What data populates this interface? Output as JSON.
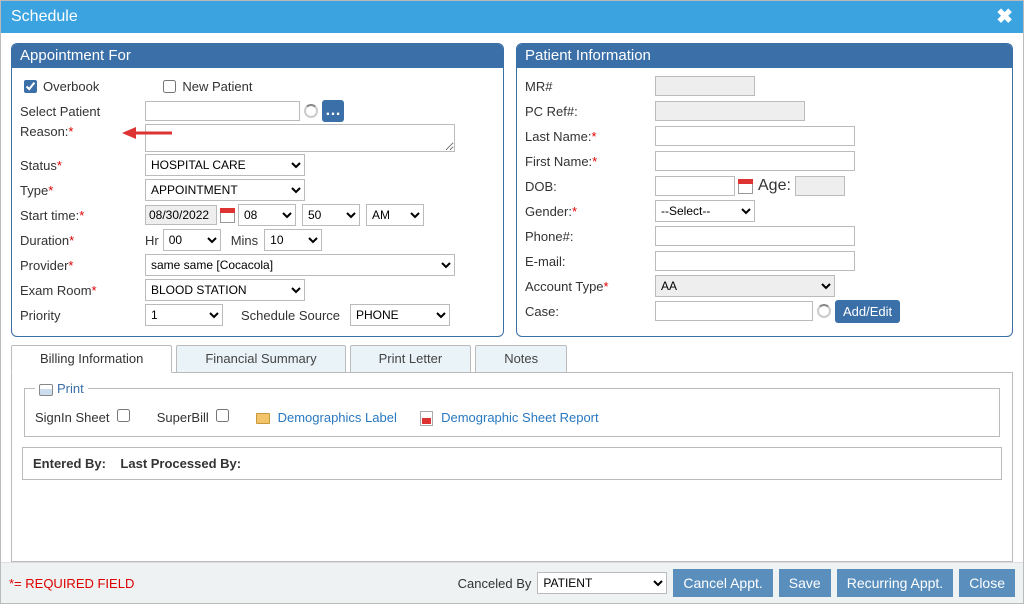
{
  "window": {
    "title": "Schedule"
  },
  "appointment": {
    "header": "Appointment For",
    "overbook": {
      "label": "Overbook",
      "checked": true
    },
    "new_patient": {
      "label": "New Patient",
      "checked": false
    },
    "select_patient_label": "Select Patient",
    "select_patient_value": "",
    "reason_label": "Reason:",
    "reason_value": "",
    "status_label": "Status",
    "status_value": "HOSPITAL CARE",
    "type_label": "Type",
    "type_value": "APPOINTMENT",
    "start_time_label": "Start time:",
    "start_date": "08/30/2022",
    "start_hour": "08",
    "start_min": "50",
    "start_ampm": "AM",
    "duration_label": "Duration",
    "duration_hr_label": "Hr",
    "duration_hr": "00",
    "duration_min_label": "Mins",
    "duration_min": "10",
    "provider_label": "Provider",
    "provider_value": "same same [Cocacola]",
    "exam_room_label": "Exam Room",
    "exam_room_value": "BLOOD STATION",
    "priority_label": "Priority",
    "priority_value": "1",
    "schedule_source_label": "Schedule Source",
    "schedule_source_value": "PHONE"
  },
  "patient": {
    "header": "Patient Information",
    "mr_label": "MR#",
    "pc_ref_label": "PC Ref#:",
    "last_name_label": "Last Name:",
    "first_name_label": "First Name:",
    "dob_label": "DOB:",
    "age_label": "Age:",
    "gender_label": "Gender:",
    "gender_value": "--Select--",
    "phone_label": "Phone#:",
    "email_label": "E-mail:",
    "account_type_label": "Account Type",
    "account_type_value": "AA",
    "case_label": "Case:",
    "add_edit": "Add/Edit"
  },
  "tabs": {
    "billing": "Billing Information",
    "financial": "Financial Summary",
    "print_letter": "Print Letter",
    "notes": "Notes"
  },
  "print": {
    "legend": "Print",
    "signin_sheet": "SignIn Sheet",
    "superbill": "SuperBill",
    "demographics_label": "Demographics Label",
    "demographic_sheet_report": "Demographic Sheet Report"
  },
  "entered": {
    "entered_by": "Entered By:",
    "last_processed_by": "Last Processed By:"
  },
  "footer": {
    "required_note": "*= REQUIRED FIELD",
    "canceled_by_label": "Canceled By",
    "canceled_by_value": "PATIENT",
    "cancel_appt": "Cancel Appt.",
    "save": "Save",
    "recurring": "Recurring Appt.",
    "close": "Close"
  }
}
